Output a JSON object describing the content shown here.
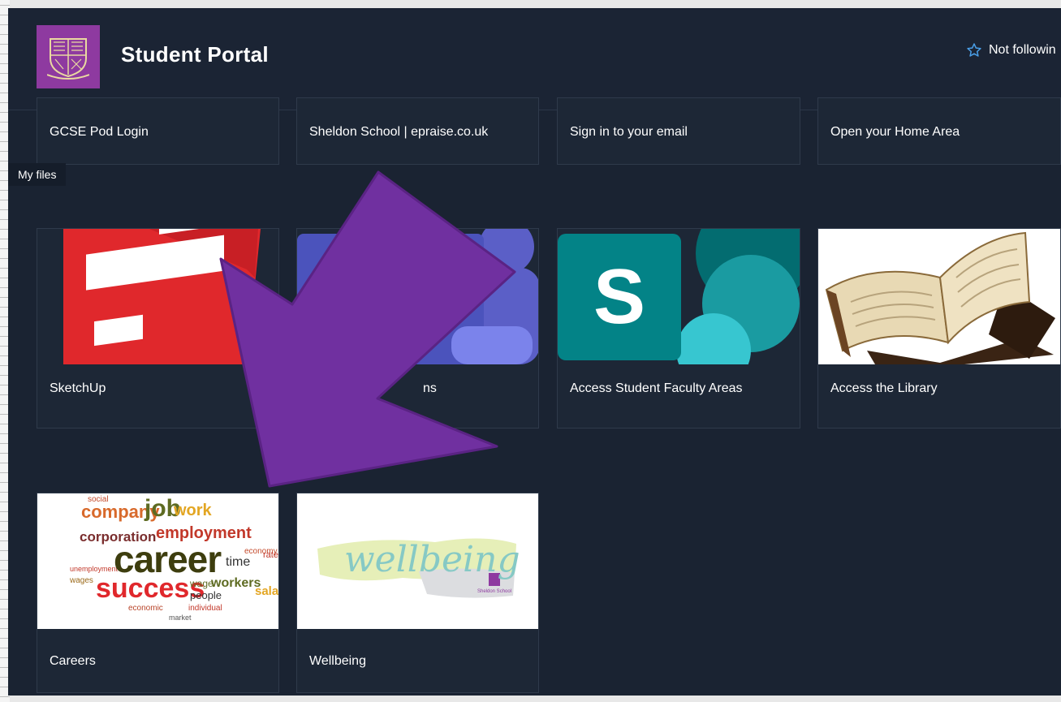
{
  "header": {
    "site_title": "Student Portal",
    "follow_label": "Not followin"
  },
  "tooltip": {
    "text": "My files"
  },
  "row1": [
    {
      "label": "GCSE Pod Login"
    },
    {
      "label": "Sheldon School | epraise.co.uk"
    },
    {
      "label": "Sign in to your email"
    },
    {
      "label": "Open your Home Area"
    }
  ],
  "row2": [
    {
      "label": "SketchUp",
      "icon": "sketchup-logo"
    },
    {
      "label": "ns",
      "icon": "teams-logo"
    },
    {
      "label": "Access Student Faculty Areas",
      "icon": "sharepoint-logo"
    },
    {
      "label": "Access the Library",
      "icon": "open-book-image"
    }
  ],
  "row3": [
    {
      "label": "Careers",
      "icon": "career-word-cloud"
    },
    {
      "label": "Wellbeing",
      "icon": "wellbeing-banner"
    }
  ],
  "thumb_text": {
    "sharepoint_letter": "S",
    "wellbeing_word": "wellbeing",
    "wellbeing_school": "Sheldon School",
    "career_words": {
      "career": "career",
      "success": "success",
      "job": "job",
      "company": "company",
      "work": "work",
      "corporation": "corporation",
      "employment": "employment",
      "time": "time",
      "workers": "workers",
      "people": "people",
      "wage": "wage",
      "salary": "salary",
      "wages": "wages",
      "economic": "economic",
      "individual": "individual",
      "market": "market",
      "unemployment": "unemployment",
      "social": "social",
      "economy": "economy",
      "rate": "rate"
    }
  },
  "colors": {
    "page_bg": "#1a2332",
    "logo_bg": "#8e3aa0",
    "arrow_fill": "#7030a0",
    "follow_star": "#4a9fe8",
    "sketchup_red": "#e0282c",
    "teams_purple": "#5059c9",
    "sharepoint_teal": "#038387"
  }
}
